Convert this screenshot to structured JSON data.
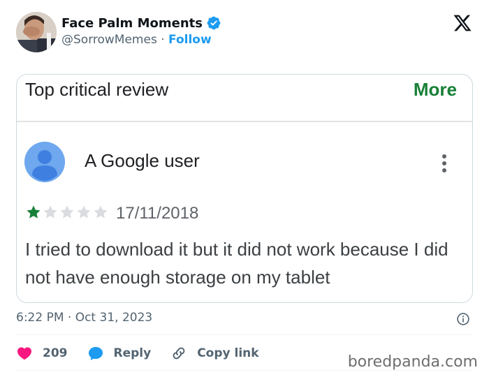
{
  "tweet": {
    "display_name": "Face Palm Moments",
    "handle": "@SorrowMemes",
    "separator": "·",
    "follow_label": "Follow",
    "timestamp": "6:22 PM · Oct 31, 2023",
    "verified": true,
    "colors": {
      "accent": "#1d9bf0",
      "like": "#f91880",
      "muted": "#536471"
    }
  },
  "card": {
    "title": "Top critical review",
    "more_label": "More",
    "user_name": "A Google user",
    "rating": 1,
    "max_rating": 5,
    "date": "17/11/2018",
    "review_text": "I tried to download it but it did not work because I did not have enough storage on my tablet",
    "colors": {
      "more": "#188038",
      "star_filled": "#188038",
      "star_empty": "#dadce0",
      "avatar": "#6fa8ee"
    }
  },
  "actions": {
    "like_count": "209",
    "reply_label": "Reply",
    "copy_link_label": "Copy link"
  },
  "watermark": "boredpanda.com"
}
